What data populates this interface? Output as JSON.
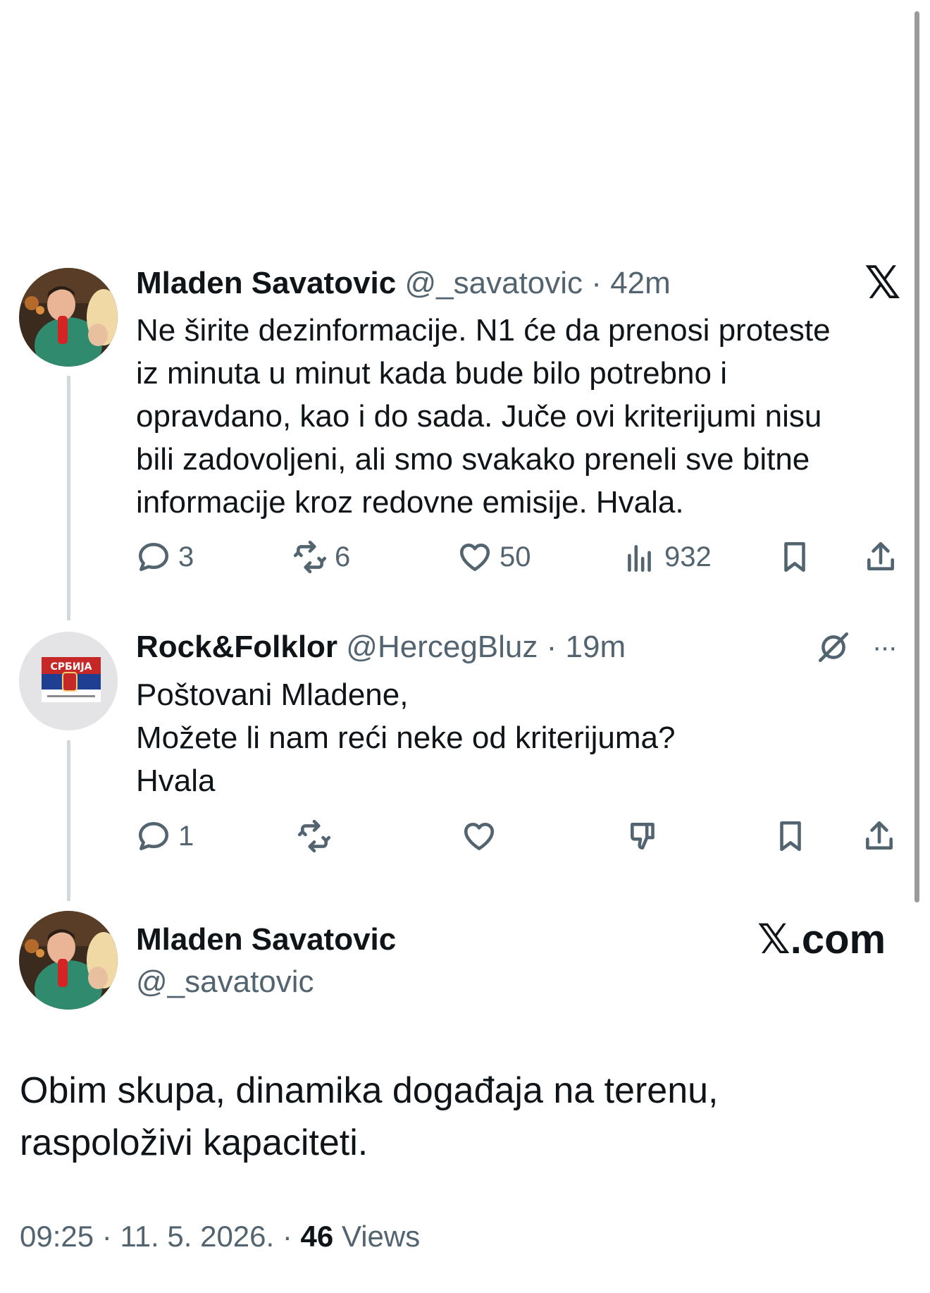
{
  "tweet1": {
    "name": "Mladen Savatovic",
    "handle": "@_savatovic",
    "separator": "·",
    "time": "42m",
    "lines": [
      "Ne širite dezinformacije. N1 će da prenosi proteste",
      "iz minuta u minut kada bude bilo potrebno i",
      "opravdano, kao i do sada. Juče ovi kriterijumi nisu",
      "bili zadovoljeni, ali smo svakako preneli sve bitne",
      "informacije kroz redovne emisije. Hvala."
    ],
    "replies": "3",
    "reposts": "6",
    "likes": "50",
    "views": "932",
    "logo": "𝕏"
  },
  "tweet2": {
    "name": "Rock&Folklor",
    "handle": "@HercegBluz",
    "separator": "·",
    "time": "19m",
    "lines": [
      "Poštovani Mladene,",
      "Možete li nam reći neke od kriterijuma?",
      "Hvala"
    ],
    "replies": "1",
    "more": "···",
    "avatar_flag_text": "СРБИЈА"
  },
  "main_tweet": {
    "name": "Mladen Savatovic",
    "handle": "@_savatovic",
    "brand": "𝕏.com",
    "lines": [
      "Obim skupa, dinamika događaja na terenu,",
      "raspoloživi kapaciteti."
    ],
    "time": "09:25",
    "separator": "·",
    "date": "11. 5. 2026.",
    "views_count": "46",
    "views_label": "Views"
  },
  "icons": {
    "reply": "reply-icon",
    "repost": "repost-icon",
    "like": "like-icon",
    "views": "views-icon",
    "bookmark": "bookmark-icon",
    "share": "share-icon",
    "grok": "grok-icon",
    "dislike": "dislike-icon"
  },
  "colors": {
    "text": "#0f1419",
    "secondary": "#536471",
    "thread_line": "#cfd9de"
  }
}
